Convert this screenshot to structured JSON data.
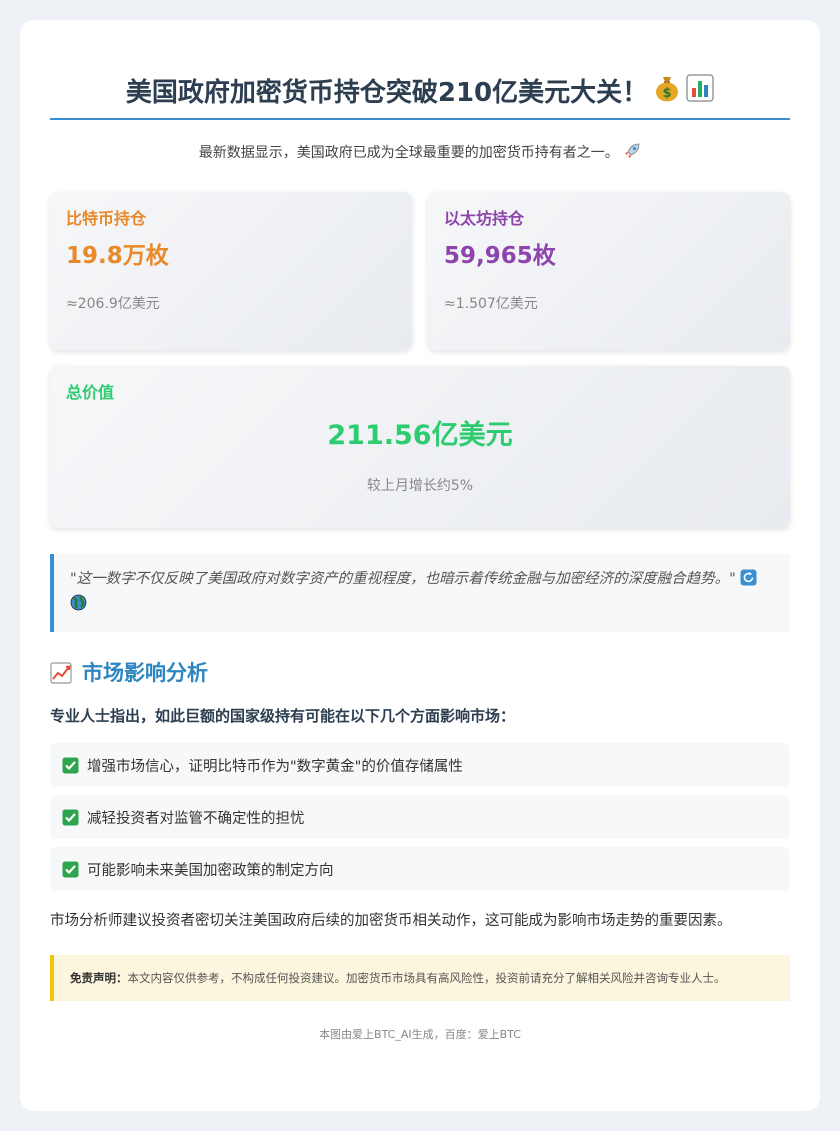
{
  "header": {
    "title": "美国政府加密货币持仓突破210亿美元大关！",
    "title_icons": [
      "money-bag-icon",
      "bar-chart-icon"
    ]
  },
  "intro": {
    "text": "最新数据显示，美国政府已成为全球最重要的加密货币持有者之一。",
    "icon": "rocket-icon"
  },
  "stats": {
    "btc": {
      "label": "比特币持仓",
      "value": "19.8万枚",
      "sub": "≈206.9亿美元",
      "color": "#e8892a"
    },
    "eth": {
      "label": "以太坊持仓",
      "value": "59,965枚",
      "sub": "≈1.507亿美元",
      "color": "#8e44ad"
    },
    "total": {
      "label": "总价值",
      "value": "211.56亿美元",
      "sub": "较上月增长约5%",
      "color": "#2ecc71"
    }
  },
  "quote": {
    "text": "\"这一数字不仅反映了美国政府对数字资产的重视程度，也暗示着传统金融与加密经济的深度融合趋势。\"",
    "icons": [
      "refresh-icon",
      "earth-icon"
    ]
  },
  "analysis": {
    "title": "市场影响分析",
    "icon": "trend-up-chart-icon",
    "lead": "专业人士指出，如此巨额的国家级持有可能在以下几个方面影响市场：",
    "items": [
      {
        "text": "增强市场信心，证明比特币作为\"数字黄金\"的价值存储属性"
      },
      {
        "text": "减轻投资者对监管不确定性的担忧"
      },
      {
        "text": "可能影响未来美国加密政策的制定方向"
      }
    ],
    "closing": "市场分析师建议投资者密切关注美国政府后续的加密货币相关动作，这可能成为影响市场走势的重要因素。"
  },
  "disclaimer": {
    "label": "免责声明：",
    "text": "本文内容仅供参考，不构成任何投资建议。加密货币市场具有高风险性，投资前请充分了解相关风险并咨询专业人士。"
  },
  "footer": {
    "text": "本图由爱上BTC_AI生成，百度：爱上BTC"
  },
  "colors": {
    "accent": "#3a8fd0",
    "section": "#2e86c1",
    "warning": "#f1c40f",
    "check": "#2ea44f"
  }
}
